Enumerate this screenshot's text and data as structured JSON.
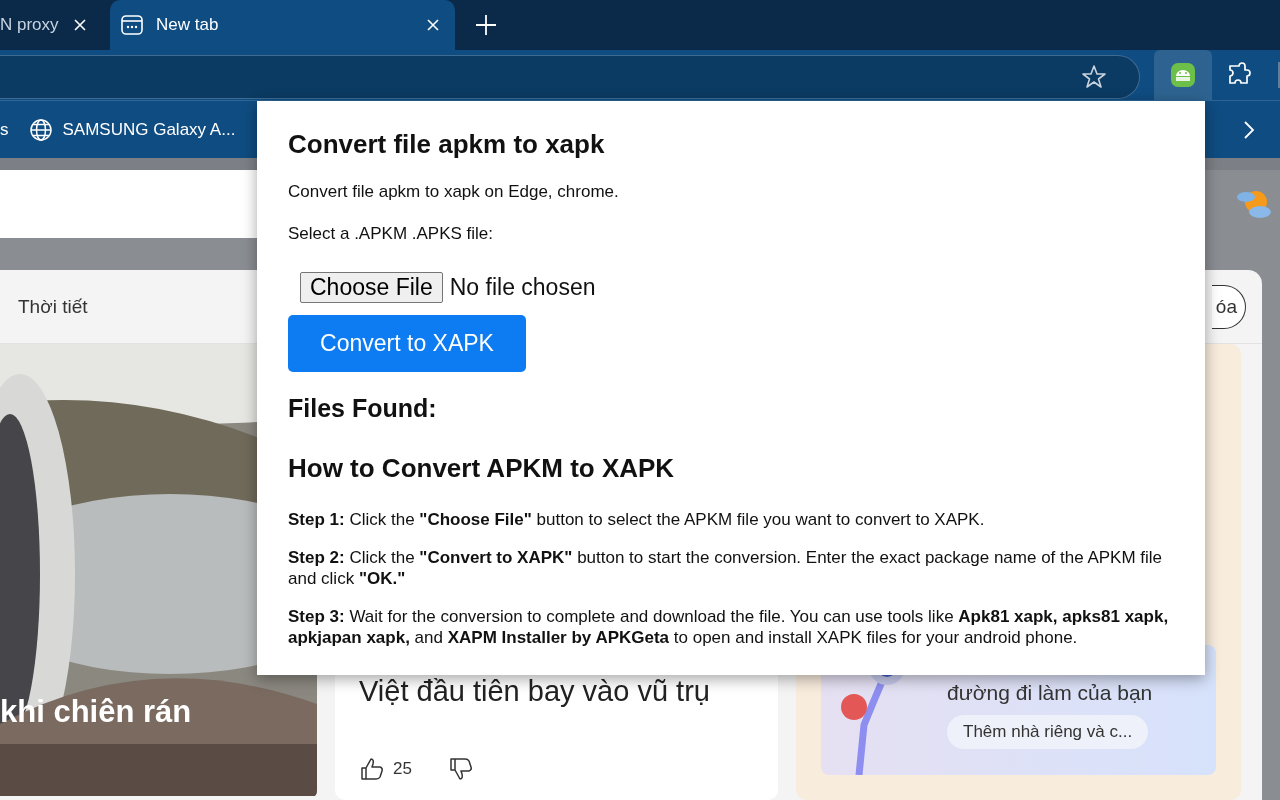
{
  "tabs": [
    {
      "label": "N proxy",
      "selected": false
    },
    {
      "label": "New tab",
      "selected": true
    }
  ],
  "bookmarks": [
    {
      "label": "s"
    },
    {
      "label": "SAMSUNG Galaxy A..."
    }
  ],
  "feed": {
    "nav_item": "Thời tiết",
    "pill_button": "óa",
    "cards": [
      {
        "headline": "khi chiên rán"
      },
      {
        "kind": "article",
        "headline": "Việt đầu tiên bay vào vũ trụ",
        "likes": "25"
      },
      {
        "kind": "traffic",
        "headline": "đường đi làm của bạn",
        "action": "Thêm nhà riêng và c..."
      }
    ]
  },
  "popup": {
    "title": "Convert file apkm to xapk",
    "description": "Convert file apkm to xapk on Edge, chrome.",
    "select_label": "Select a .APKM .APKS file:",
    "file_button": "Choose File",
    "file_status": "No file chosen",
    "convert_button": "Convert to XAPK",
    "files_heading": "Files Found:",
    "howto_heading": "How to Convert APKM to XAPK",
    "steps": [
      "**Step 1:** Click the **\"Choose File\"** button to select the APKM file you want to convert to XAPK.",
      "**Step 2:** Click the **\"Convert to XAPK\"** button to start the conversion. Enter the exact package name of the APKM file and click **\"OK.\"**",
      "**Step 3:** Wait for the conversion to complete and download the file. You can use tools like **Apk81 xapk, apks81 xapk, apkjapan xapk,** and **XAPM Installer by APKGeta** to open and install XAPK files for your android phone."
    ]
  }
}
